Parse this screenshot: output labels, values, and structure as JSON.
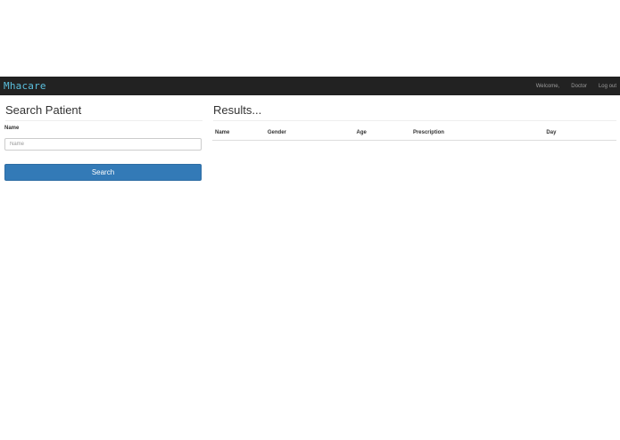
{
  "navbar": {
    "brand": "Mhacare",
    "welcome": "Welcome,",
    "user": "Doctor",
    "logout": "Log out"
  },
  "search": {
    "title": "Search Patient",
    "name_label": "Name",
    "name_placeholder": "Name",
    "name_value": "",
    "button_label": "Search"
  },
  "results": {
    "title": "Results...",
    "columns": [
      "Name",
      "Gender",
      "Age",
      "Prescription",
      "Day"
    ]
  }
}
